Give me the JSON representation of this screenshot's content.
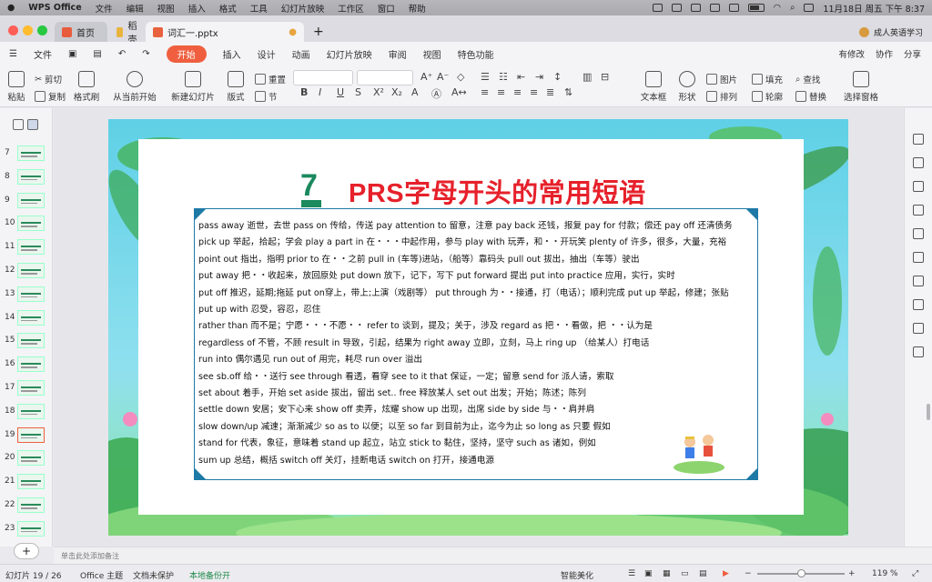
{
  "menubar": {
    "app_name": "WPS Office",
    "items": [
      "文件",
      "编辑",
      "视图",
      "插入",
      "格式",
      "工具",
      "幻灯片放映",
      "工作区",
      "窗口",
      "帮助"
    ],
    "datetime": "11月18日 周五 下午 8:37"
  },
  "tabs": {
    "home": "首页",
    "docer": "稻壳",
    "file": "词汇一.pptx",
    "new_tab": "+",
    "account": "成人英语学习"
  },
  "ribbon_menu": {
    "file_label": "文件",
    "items": [
      "开始",
      "插入",
      "设计",
      "动画",
      "幻灯片放映",
      "审阅",
      "视图",
      "特色功能"
    ],
    "active": "开始",
    "right": [
      "有修改",
      "协作",
      "分享"
    ]
  },
  "toolbar": {
    "paste": "粘贴",
    "cut": "剪切",
    "copy": "复制",
    "format_painter": "格式刷",
    "play_from_current": "从当前开始",
    "new_slide": "新建幻灯片",
    "layout": "版式",
    "section": "节",
    "reset": "重置",
    "textbox": "文本框",
    "shape": "形状",
    "picture": "图片",
    "arrange": "排列",
    "fill": "填充",
    "outline": "轮廓",
    "find": "查找",
    "replace": "替换",
    "select_pane": "选择窗格"
  },
  "thumbnails": [
    {
      "num": "7"
    },
    {
      "num": "8"
    },
    {
      "num": "9"
    },
    {
      "num": "10"
    },
    {
      "num": "11"
    },
    {
      "num": "12"
    },
    {
      "num": "13"
    },
    {
      "num": "14"
    },
    {
      "num": "15"
    },
    {
      "num": "16"
    },
    {
      "num": "17"
    },
    {
      "num": "18"
    },
    {
      "num": "19"
    },
    {
      "num": "20"
    },
    {
      "num": "21"
    },
    {
      "num": "22"
    },
    {
      "num": "23"
    }
  ],
  "selected_slide": "19",
  "add_slide": "+",
  "slide": {
    "number": "7",
    "title": "PRS字母开头的常用短语",
    "lines": [
      "pass away 逝世，去世 pass on 传给，传送 pay attention to 留意，注意 pay back 还钱，报复 pay for 付款；偿还 pay off 还清债务",
      "pick up 举起，拾起；学会 play a part in 在・・・中起作用，参与 play with 玩弄，和・・开玩笑 plenty of 许多，很多，大量，充裕",
      "point out 指出，指明 prior to 在・・之前 pull in (车等)进站，（船等）靠码头  pull out 拔出，抽出（车等）驶出",
      "put away 把・・收起来，放回原处 put down 放下，记下，写下 put forward 提出 put into practice 应用，实行，实时",
      "put off 推迟，延期;拖延 put on穿上，带上;上演（戏剧等） put through 为・・接通，打（电话）；顺利完成 put up 举起，修建；张贴",
      "put up with 忍受，容忍，忍住",
      "rather than 而不是；宁愿・・・不愿・・ refer to 谈到，提及；关于，涉及 regard as 把・・看做，把 ・・认为是",
      "regardless of 不管，不顾 result in 导致，引起，结果为 right away 立即，立刻，马上 ring up （给某人）打电话",
      "run into 偶尔遇见 run out of 用完，耗尽 run over 溢出",
      "see sb.off 给・・送行 see through 看透，看穿 see to it that 保证，一定；留意 send for 派人请，索取",
      "set about 着手，开始 set aside 拔出，留出 set.. free 释放某人 set out 出发；开始；陈述；陈列",
      "settle down 安居；安下心来 show off 卖弄，炫耀 show up 出现，出席 side by side 与・・肩并肩",
      "slow down/up 减速；渐渐减少 so as to 以便；以至 so far 到目前为止，迄今为止 so long as 只要 假如",
      "stand for 代表，象征，意味着 stand up 起立，站立 stick to 黏住，坚持，坚守 such as 诸如，例如",
      "sum up 总结，概括 switch off 关灯，挂断电话 switch on 打开，接通电源"
    ]
  },
  "notes_placeholder": "单击此处添加备注",
  "status": {
    "slide_counter": "幻灯片 19 / 26",
    "theme": "Office 主题",
    "protect": "文档未保护",
    "backup": "本地备份开",
    "beautify": "智能美化",
    "zoom": "119 %",
    "zoom_minus": "−",
    "zoom_plus": "+"
  }
}
